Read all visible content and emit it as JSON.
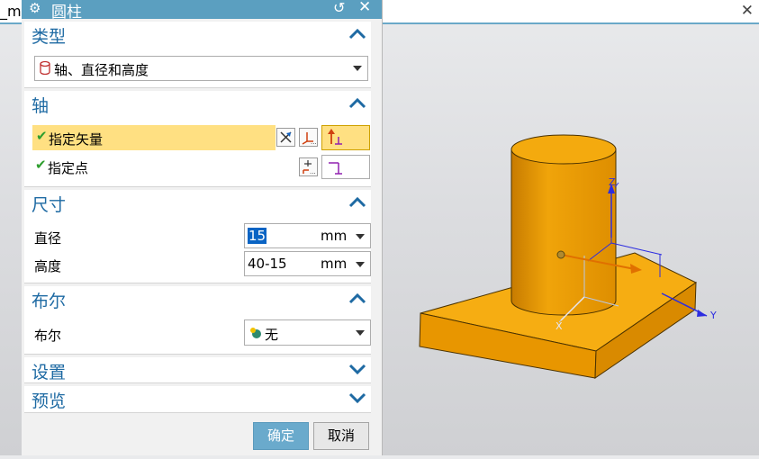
{
  "tab": {
    "text": "_mo"
  },
  "dialog": {
    "title": "圆柱",
    "groups": {
      "type": {
        "header": "类型",
        "value": "轴、直径和高度"
      },
      "axis": {
        "header": "轴",
        "vector_label": "指定矢量",
        "point_label": "指定点"
      },
      "dimensions": {
        "header": "尺寸",
        "diameter": {
          "label": "直径",
          "value": "15",
          "unit": "mm"
        },
        "height": {
          "label": "高度",
          "value": "40-15",
          "unit": "mm"
        }
      },
      "boolean": {
        "header": "布尔",
        "label": "布尔",
        "value": "无"
      },
      "settings": {
        "header": "设置"
      },
      "preview": {
        "header": "预览"
      }
    },
    "buttons": {
      "ok": "确定",
      "cancel": "取消"
    }
  },
  "viewport": {
    "axis_z": "Z",
    "axis_y": "Y",
    "axis_x": "X"
  },
  "colors": {
    "accent": "#5b9fc0",
    "group_header": "#1e6aa3",
    "highlight": "#ffe082",
    "model": "#f2a400"
  },
  "icons": [
    "gear-icon",
    "reset-icon",
    "close-icon",
    "chevron-up-icon",
    "chevron-down-icon",
    "dropdown-arrow-icon",
    "check-icon",
    "vector-dialog-icon",
    "inferred-vector-icon",
    "point-dialog-icon",
    "boolean-icon",
    "type-icon"
  ]
}
